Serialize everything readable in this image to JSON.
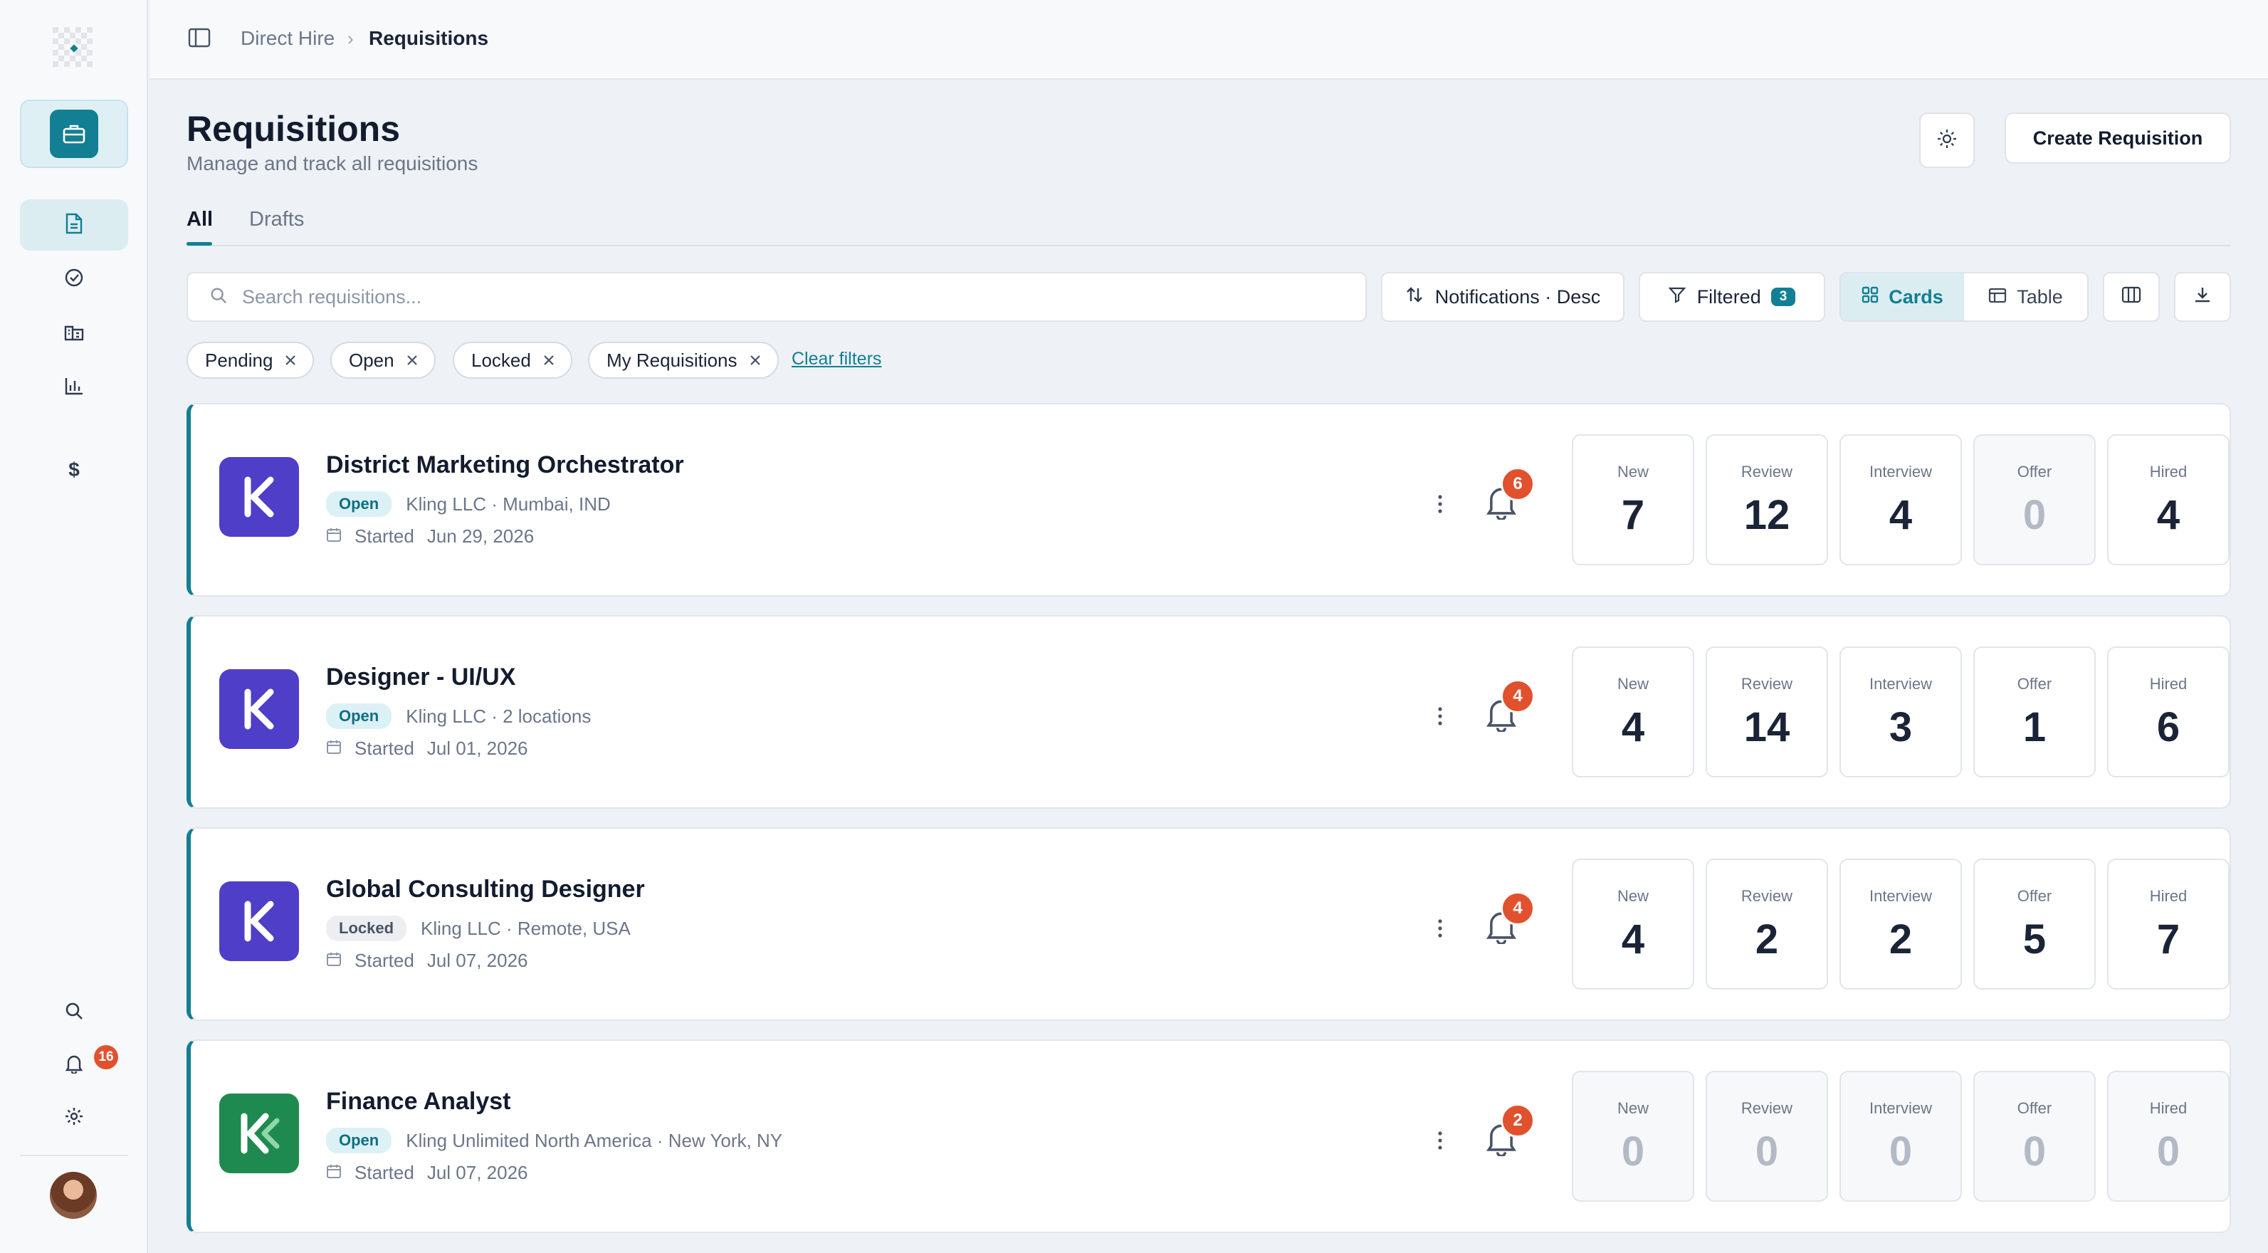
{
  "breadcrumb": {
    "parent": "Direct Hire",
    "separator": "›",
    "current": "Requisitions"
  },
  "page": {
    "title": "Requisitions",
    "subtitle": "Manage and track all requisitions"
  },
  "header": {
    "create_label": "Create Requisition"
  },
  "tabs": [
    {
      "label": "All",
      "active": true
    },
    {
      "label": "Drafts",
      "active": false
    }
  ],
  "search": {
    "placeholder": "Search requisitions...",
    "value": ""
  },
  "toolbar": {
    "sort_label": "Notifications · Desc",
    "filter_label": "Filtered",
    "filter_count": "3",
    "view_cards": "Cards",
    "view_table": "Table",
    "active_view": "Cards"
  },
  "chips": [
    "Pending",
    "Open",
    "Locked",
    "My Requisitions"
  ],
  "clear_filters": "Clear filters",
  "sidebar": {
    "notification_count": "16",
    "icons": [
      "briefcase-icon",
      "document-icon",
      "check-circle-icon",
      "building-icon",
      "bar-chart-icon",
      "dollar-icon",
      "search-icon",
      "bell-icon",
      "gear-icon"
    ]
  },
  "colors": {
    "accent": "#127f93",
    "badge": "#e1512d",
    "kling_purple": "#4f3ec8",
    "kling_green": "#1e8a4f"
  },
  "stat_labels": [
    "New",
    "Review",
    "Interview",
    "Offer",
    "Hired"
  ],
  "requisitions": [
    {
      "title": "District Marketing Orchestrator",
      "status": "Open",
      "meta": "Kling LLC · Mumbai, IND",
      "started_label": "Started",
      "started": "Jun 29, 2026",
      "notifications": "6",
      "logo": "kling-purple",
      "stats": {
        "new": "7",
        "review": "12",
        "interview": "4",
        "offer": "0",
        "hired": "4"
      }
    },
    {
      "title": "Designer - UI/UX",
      "status": "Open",
      "meta": "Kling LLC · 2 locations",
      "started_label": "Started",
      "started": "Jul 01, 2026",
      "notifications": "4",
      "logo": "kling-purple",
      "stats": {
        "new": "4",
        "review": "14",
        "interview": "3",
        "offer": "1",
        "hired": "6"
      }
    },
    {
      "title": "Global Consulting Designer",
      "status": "Locked",
      "meta": "Kling LLC · Remote, USA",
      "started_label": "Started",
      "started": "Jul 07, 2026",
      "notifications": "4",
      "logo": "kling-purple",
      "stats": {
        "new": "4",
        "review": "2",
        "interview": "2",
        "offer": "5",
        "hired": "7"
      }
    },
    {
      "title": "Finance Analyst",
      "status": "Open",
      "meta": "Kling Unlimited North America · New York, NY",
      "started_label": "Started",
      "started": "Jul 07, 2026",
      "notifications": "2",
      "logo": "kling-green",
      "stats": {
        "new": "0",
        "review": "0",
        "interview": "0",
        "offer": "0",
        "hired": "0"
      }
    }
  ]
}
